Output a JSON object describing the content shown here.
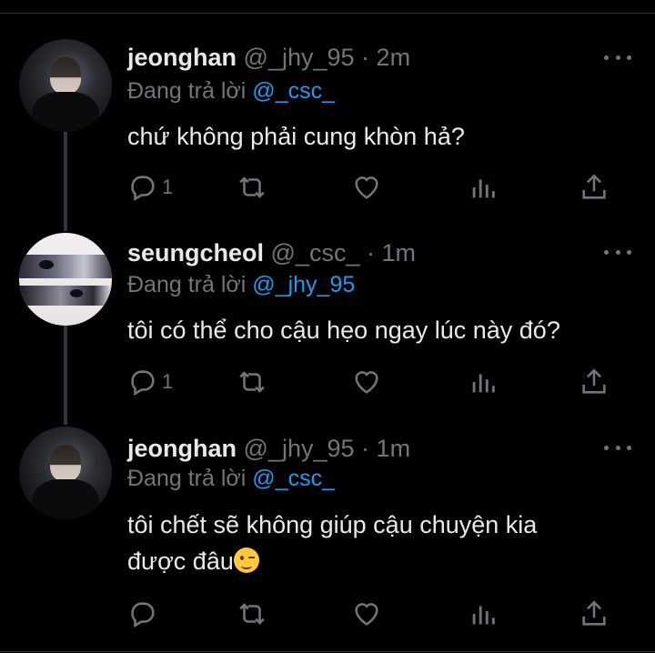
{
  "tweets": [
    {
      "name": "jeonghan",
      "handle": "@_jhy_95",
      "separator": "·",
      "time": "2m",
      "reply_prefix": "Đang trả lời",
      "reply_to": "@_csc_",
      "text": "chứ không phải cung khòn hả?",
      "reply_count": "1",
      "avatar_icon": "profile-photo-dark"
    },
    {
      "name": "seungcheol",
      "handle": "@_csc_",
      "separator": "·",
      "time": "1m",
      "reply_prefix": "Đang trả lời",
      "reply_to": "@_jhy_95",
      "text": "tôi có thể cho cậu hẹo ngay lúc này đó?",
      "reply_count": "1",
      "avatar_icon": "profile-photo-light"
    },
    {
      "name": "jeonghan",
      "handle": "@_jhy_95",
      "separator": "·",
      "time": "1m",
      "reply_prefix": "Đang trả lời",
      "reply_to": "@_csc_",
      "text_line1": "tôi chết sẽ không giúp cậu chuyện kia",
      "text_line2": "được đâu",
      "emoji": "winking-face-emoji",
      "reply_count": "",
      "avatar_icon": "profile-photo-dark"
    }
  ],
  "icons": [
    "reply-icon",
    "retweet-icon",
    "like-icon",
    "views-icon",
    "share-icon",
    "more-icon"
  ],
  "colors": {
    "background": "#000000",
    "text": "#e7e9ea",
    "muted": "#71767b",
    "mention": "#1d9bf0",
    "divider": "#2f3336"
  }
}
